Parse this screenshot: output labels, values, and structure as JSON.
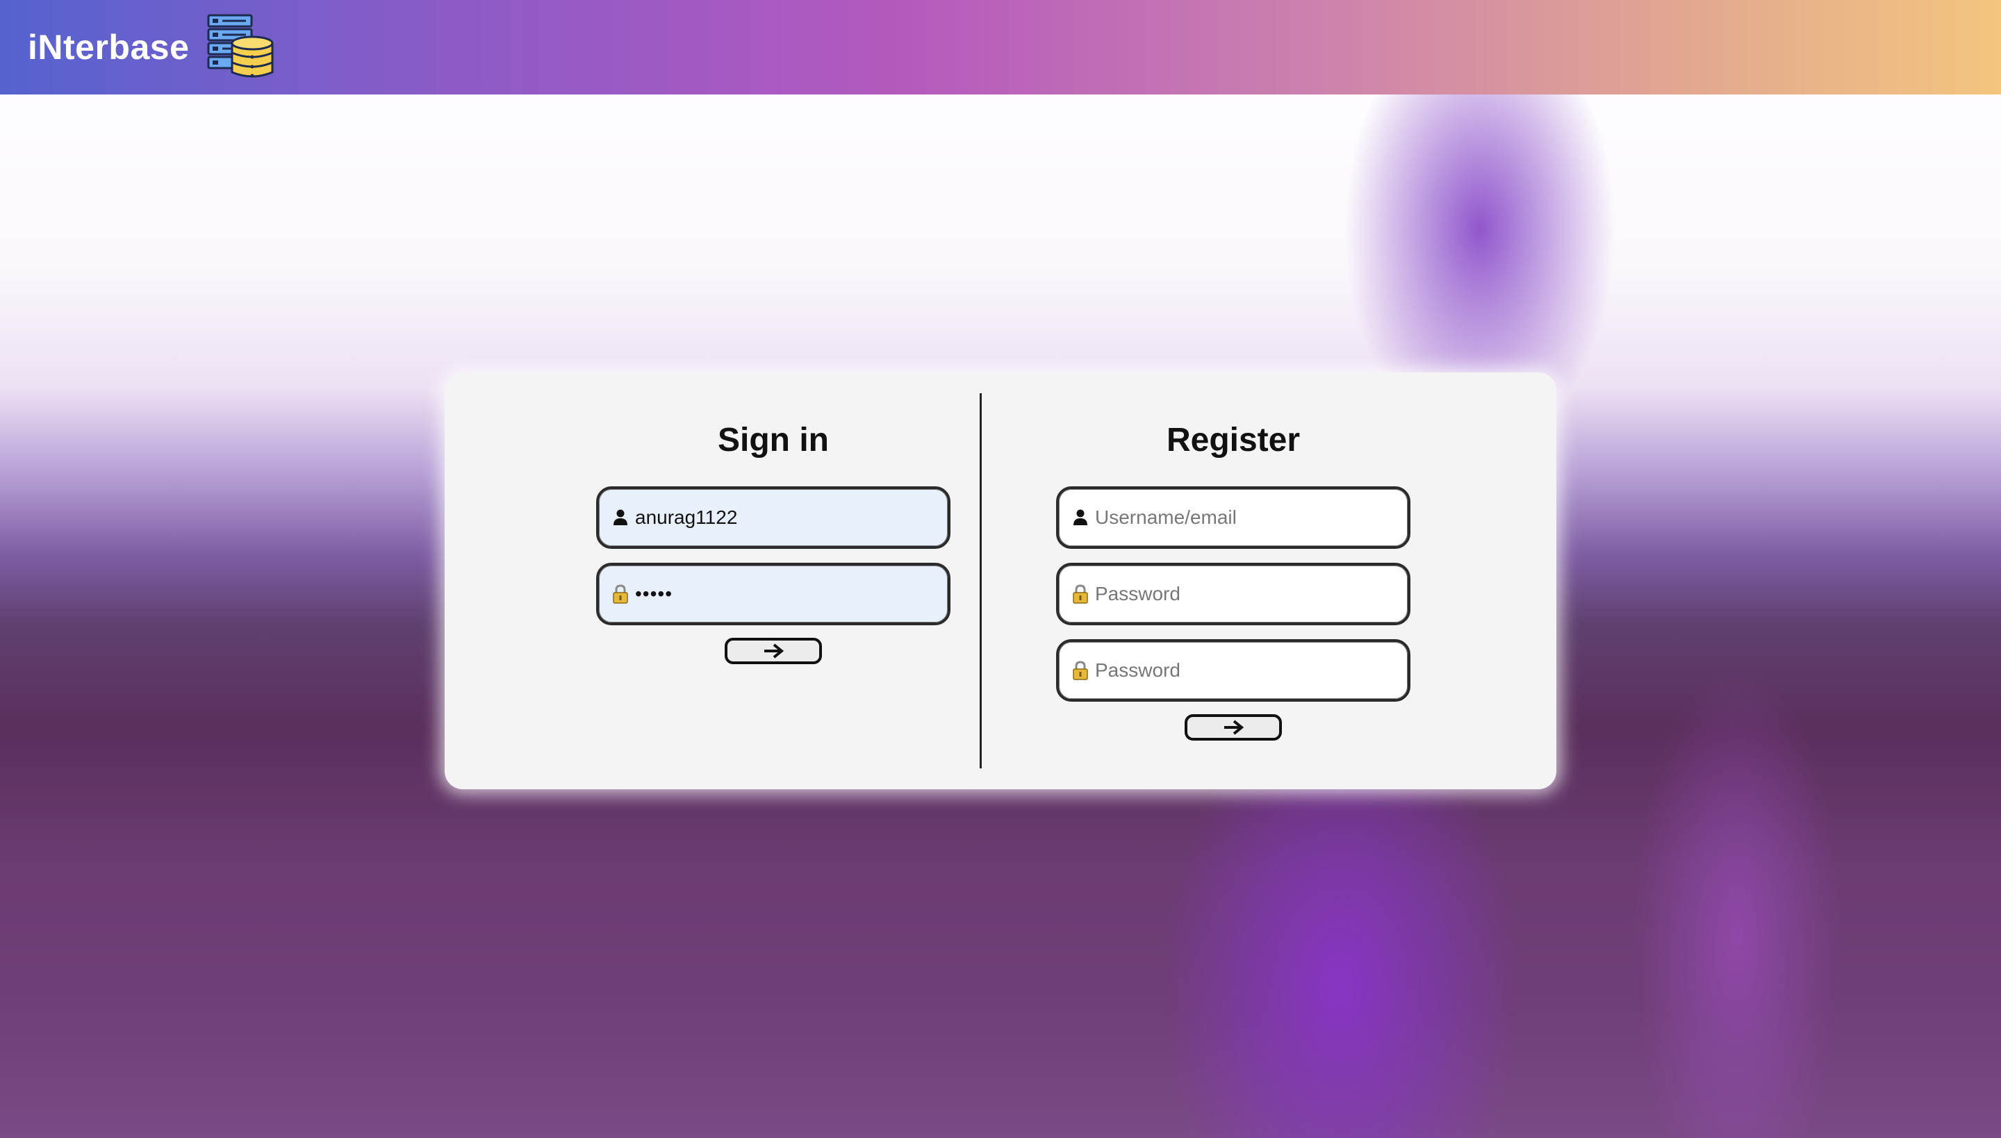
{
  "header": {
    "brand_title": "iNterbase",
    "logo_icon": "database-server-icon"
  },
  "signin": {
    "title": "Sign in",
    "username": {
      "value": "anurag1122",
      "placeholder": "Username/email",
      "icon": "user-icon"
    },
    "password": {
      "value": "•••••",
      "placeholder": "Password",
      "icon": "lock-icon"
    },
    "submit_icon": "arrow-right-icon"
  },
  "register": {
    "title": "Register",
    "username": {
      "value": "",
      "placeholder": "Username/email",
      "icon": "user-icon"
    },
    "password": {
      "value": "",
      "placeholder": "Password",
      "icon": "lock-icon"
    },
    "confirm_password": {
      "value": "",
      "placeholder": "Password",
      "icon": "lock-icon"
    },
    "submit_icon": "arrow-right-icon"
  },
  "colors": {
    "header_gradient_start": "#5563cf",
    "header_gradient_mid": "#b459be",
    "header_gradient_end": "#f4c57e",
    "card_background": "#f4f4f4",
    "filled_input_background": "#e8f0fc",
    "lock_icon": "#e6b93b"
  }
}
